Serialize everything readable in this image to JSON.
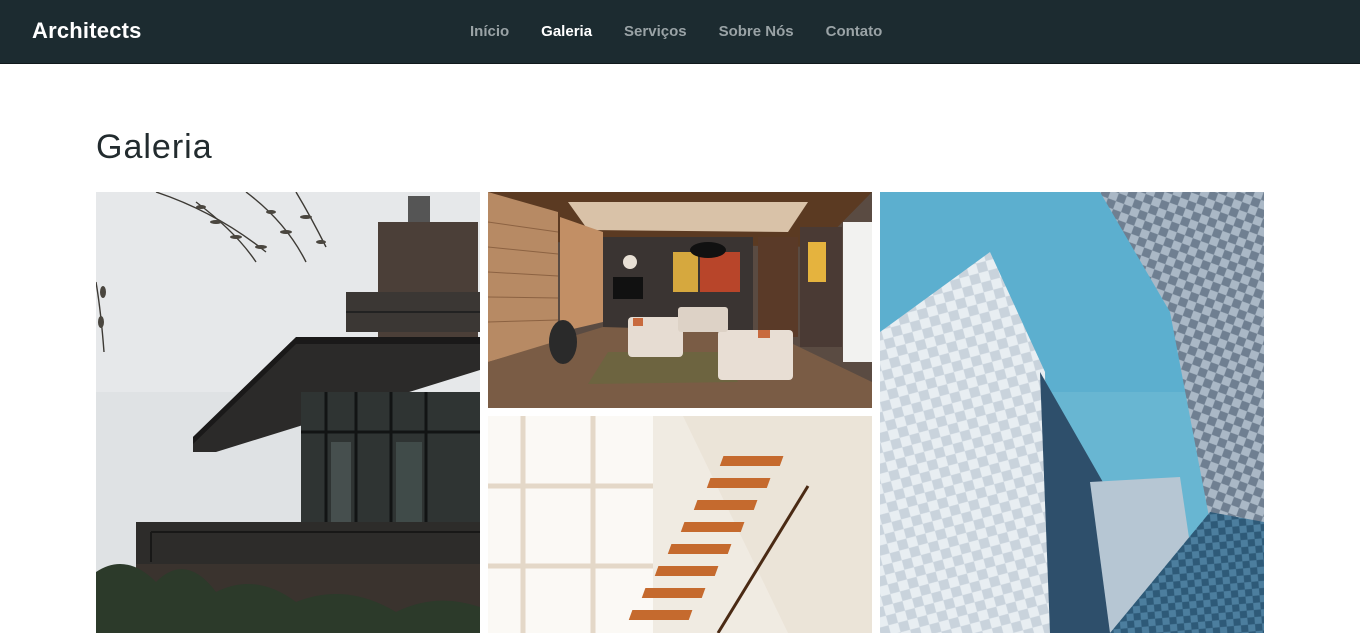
{
  "brand": {
    "name": "Architects"
  },
  "nav": {
    "items": [
      {
        "label": "Início",
        "active": false
      },
      {
        "label": "Galeria",
        "active": true
      },
      {
        "label": "Serviços",
        "active": false
      },
      {
        "label": "Sobre Nós",
        "active": false
      },
      {
        "label": "Contato",
        "active": false
      }
    ]
  },
  "main": {
    "title": "Galeria"
  },
  "colors": {
    "navbar_bg": "#1c2b30",
    "active_link": "#ffffff",
    "inactive_link": "#9aa3a6"
  }
}
